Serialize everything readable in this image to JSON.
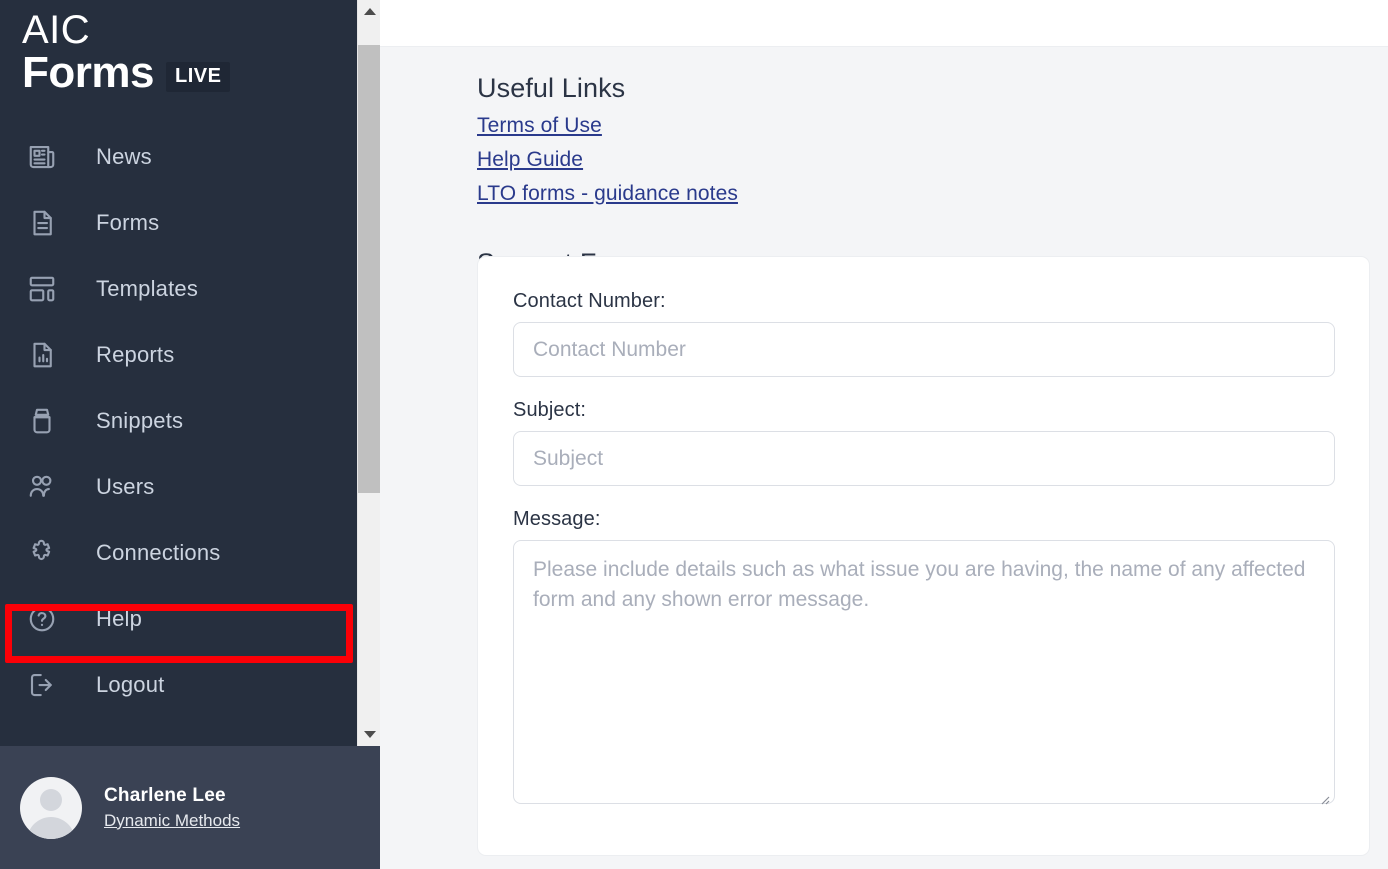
{
  "brand": {
    "line1": "AIC",
    "line2": "Forms",
    "badge": "LIVE"
  },
  "sidebar": {
    "items": [
      {
        "label": "News",
        "icon": "newspaper-icon"
      },
      {
        "label": "Forms",
        "icon": "document-icon"
      },
      {
        "label": "Templates",
        "icon": "layout-icon"
      },
      {
        "label": "Reports",
        "icon": "chart-document-icon"
      },
      {
        "label": "Snippets",
        "icon": "box-icon"
      },
      {
        "label": "Users",
        "icon": "users-icon"
      },
      {
        "label": "Connections",
        "icon": "puzzle-icon"
      },
      {
        "label": "Help",
        "icon": "question-circle-icon"
      },
      {
        "label": "Logout",
        "icon": "logout-icon"
      }
    ],
    "highlighted_item": "Help",
    "highlight_color": "#fb0007",
    "scrollbar": {
      "up_arrow": "scroll-up-arrow",
      "down_arrow": "scroll-down-arrow"
    }
  },
  "profile": {
    "name": "Charlene Lee",
    "organisation": "Dynamic Methods"
  },
  "main": {
    "useful_links": {
      "title": "Useful Links",
      "links": [
        "Terms of Use",
        "Help Guide",
        "LTO forms - guidance notes"
      ],
      "link_color": "#2a3a8c"
    },
    "support_form": {
      "title": "Support Form",
      "fields": [
        {
          "label": "Contact Number:",
          "placeholder": "Contact Number",
          "value": ""
        },
        {
          "label": "Subject:",
          "placeholder": "Subject",
          "value": ""
        },
        {
          "label": "Message:",
          "placeholder": "Please include details such as what issue you are having, the name of any affected form and any shown error message.",
          "value": ""
        }
      ]
    }
  }
}
